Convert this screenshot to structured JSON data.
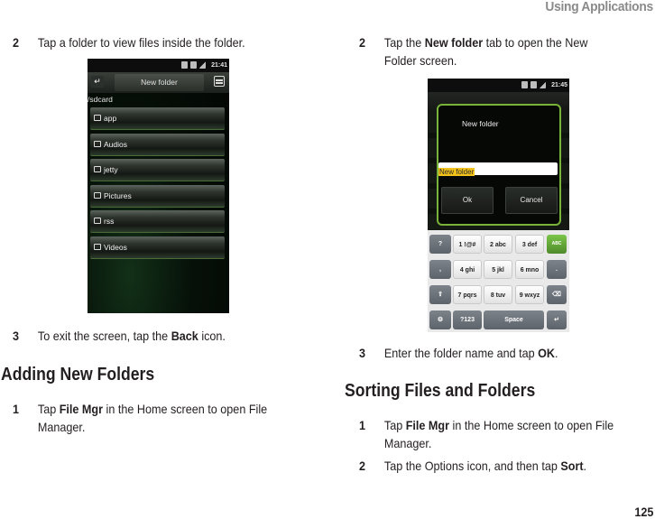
{
  "running_head": "Using Applications",
  "page_number": "125",
  "left_column": {
    "step2": {
      "num": "2",
      "text": "Tap a folder to view files inside the folder."
    },
    "screenshot1": {
      "status_time": "21:41",
      "title_tab": "New folder",
      "path": "/sdcard",
      "folders": [
        "app",
        "Audios",
        "jetty",
        "Pictures",
        "rss",
        "Videos"
      ]
    },
    "step3": {
      "num": "3",
      "pre": "To exit the screen, tap the ",
      "bold": "Back",
      "post": " icon."
    },
    "heading": "Adding New Folders",
    "step1": {
      "num": "1",
      "pre": "Tap ",
      "bold": "File Mgr",
      "post": " in the Home screen to open File",
      "line2": "Manager."
    }
  },
  "right_column": {
    "step2": {
      "num": "2",
      "pre": "Tap the ",
      "bold": "New folder",
      "post": " tab to open the New",
      "line2": "Folder screen."
    },
    "screenshot2": {
      "status_time": "21:45",
      "dialog_title": "New folder",
      "input_value": "New folder",
      "ok_label": "Ok",
      "cancel_label": "Cancel",
      "keyboard": {
        "row1": [
          "?",
          "1 !@#",
          "2 abc",
          "3 def",
          "ABC"
        ],
        "row2": [
          ",",
          "4 ghi",
          "5 jkl",
          "6 mno",
          "."
        ],
        "row3": [
          "shift",
          "7 pqrs",
          "8 tuv",
          "9 wxyz",
          "delete"
        ],
        "row4": [
          "settings",
          "?123",
          "Space",
          "enter"
        ]
      }
    },
    "step3": {
      "num": "3",
      "pre": "Enter the folder name and tap ",
      "bold": "OK",
      "post": "."
    },
    "heading": "Sorting Files and Folders",
    "step1": {
      "num": "1",
      "pre": "Tap ",
      "bold": "File Mgr",
      "post": " in the Home screen to open File",
      "line2": "Manager."
    },
    "step2b": {
      "num": "2",
      "pre": "Tap the Options icon, and then tap ",
      "bold": "Sort",
      "post": "."
    }
  }
}
